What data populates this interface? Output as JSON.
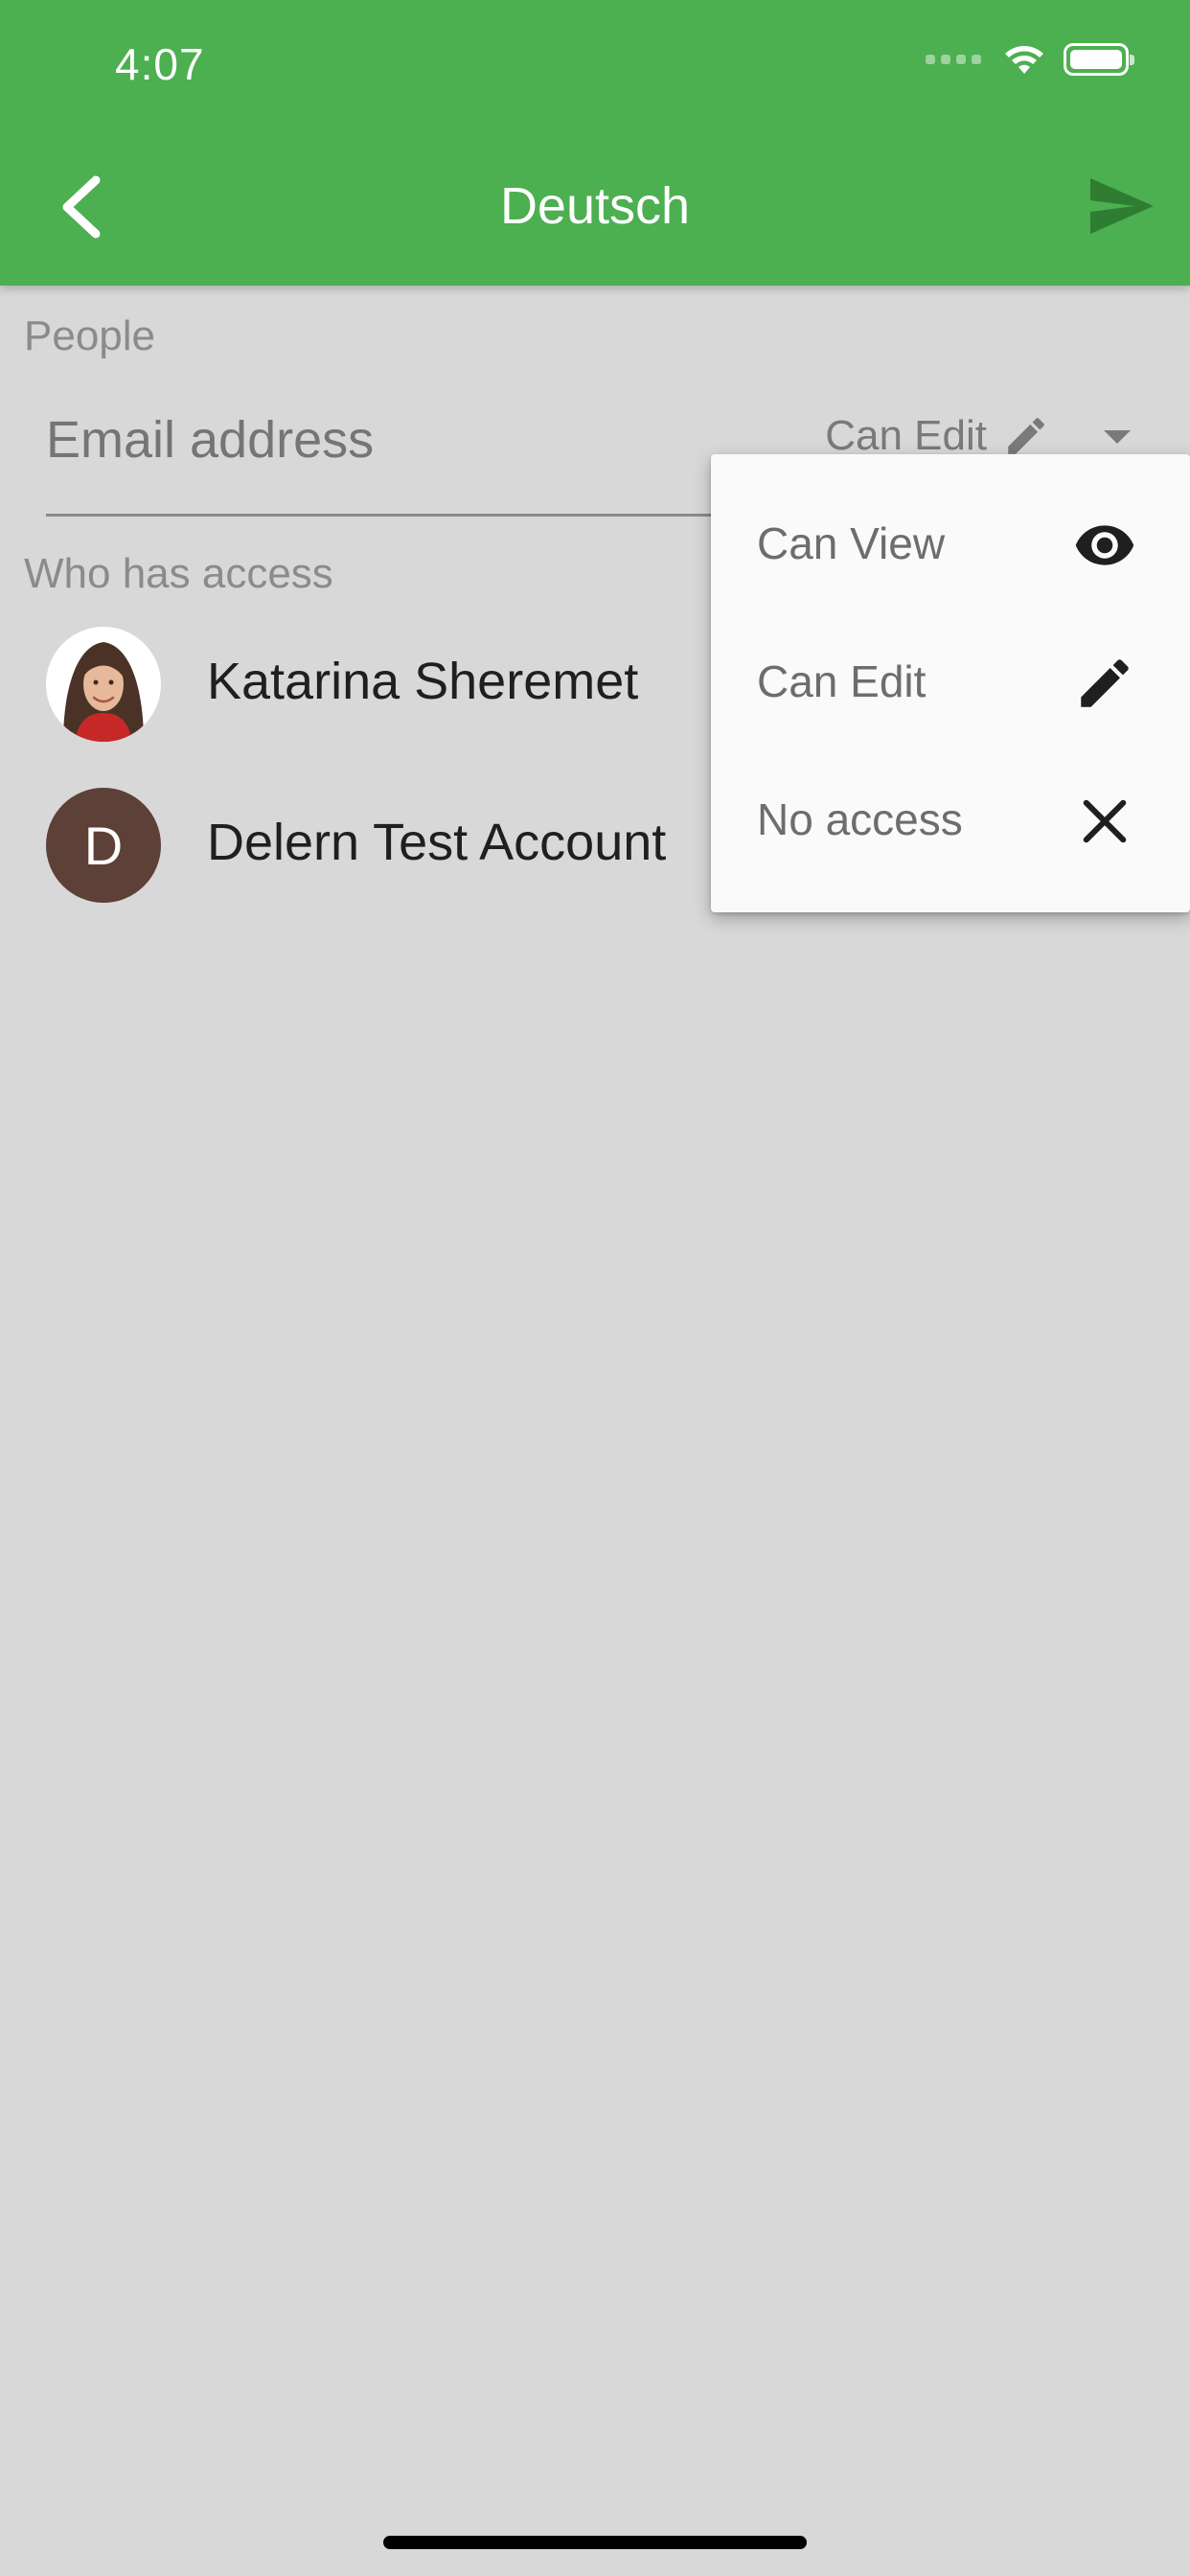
{
  "status_bar": {
    "time": "4:07"
  },
  "app_bar": {
    "title": "Deutsch",
    "back_icon": "chevron-left-icon",
    "send_icon": "send-icon"
  },
  "people_section": {
    "label": "People",
    "email_placeholder": "Email address",
    "permission_selected": "Can Edit",
    "permission_icon": "pencil-icon",
    "dropdown_icon": "arrow-drop-down-icon"
  },
  "access_section": {
    "label": "Who has access",
    "people": [
      {
        "name": "Katarina Sheremet",
        "avatar_type": "photo"
      },
      {
        "name": "Delern Test Account",
        "avatar_letter": "D",
        "avatar_color": "#5d4037"
      }
    ]
  },
  "permission_menu": {
    "items": [
      {
        "label": "Can View",
        "icon": "eye-icon"
      },
      {
        "label": "Can Edit",
        "icon": "pencil-icon"
      },
      {
        "label": "No access",
        "icon": "close-icon"
      }
    ]
  },
  "colors": {
    "app_bar": "#4caf50",
    "background": "#d8d8d8",
    "menu_background": "#fafafa",
    "send_icon": "#2e7d32"
  }
}
